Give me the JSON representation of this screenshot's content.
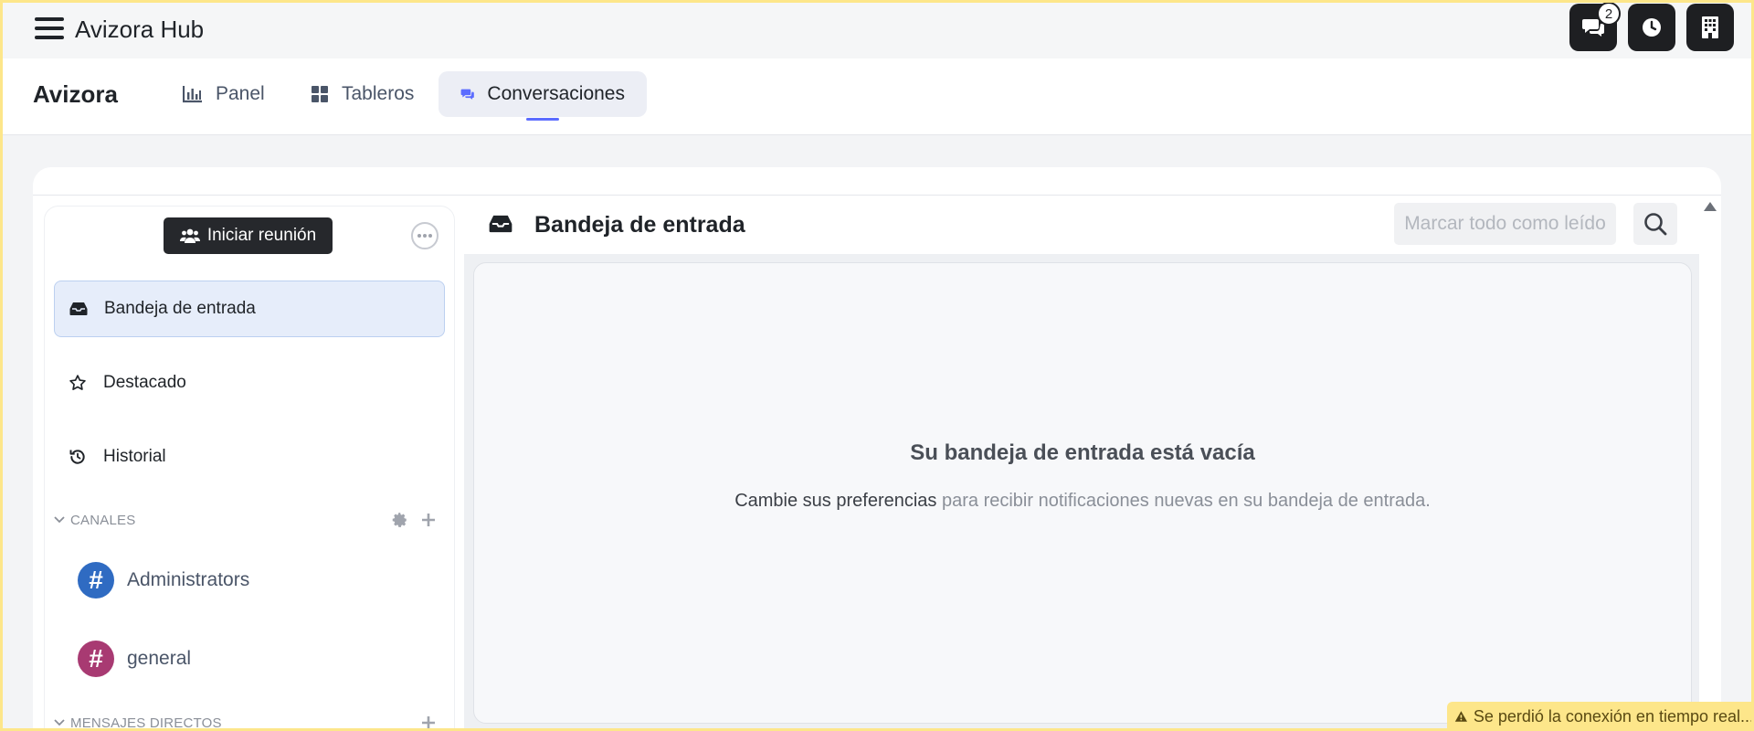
{
  "topbar": {
    "brand": "Avizora Hub",
    "chat_badge": "2"
  },
  "nav": {
    "app_name": "Avizora",
    "tabs": [
      {
        "label": "Panel",
        "icon": "bar-chart-icon"
      },
      {
        "label": "Tableros",
        "icon": "grid-icon"
      },
      {
        "label": "Conversaciones",
        "icon": "chat-icon",
        "active": true
      }
    ]
  },
  "sidebar": {
    "meeting_button": "Iniciar reunión",
    "items": [
      {
        "label": "Bandeja de entrada",
        "icon": "inbox-icon",
        "active": true
      },
      {
        "label": "Destacado",
        "icon": "star-icon"
      },
      {
        "label": "Historial",
        "icon": "history-icon"
      }
    ],
    "channels_header": "CANALES",
    "channels": [
      {
        "label": "Administrators",
        "color": "#2f6bc2"
      },
      {
        "label": "general",
        "color": "#a83a72"
      }
    ],
    "dm_header": "MENSAJES DIRECTOS"
  },
  "inbox": {
    "title": "Bandeja de entrada",
    "mark_all": "Marcar todo como leído",
    "empty_title": "Su bandeja de entrada está vacía",
    "empty_link": "Cambie sus preferencias",
    "empty_text": " para recibir notificaciones nuevas en su bandeja de entrada."
  },
  "toast": {
    "text": "Se perdió la conexión en tiempo real..."
  },
  "colors": {
    "accent": "#5b6cff",
    "dark_button": "#1e1f22",
    "warning": "#fde68a"
  }
}
